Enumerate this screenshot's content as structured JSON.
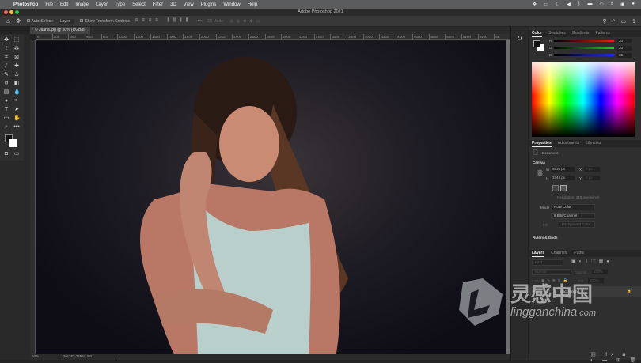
{
  "menubar": {
    "apple": "",
    "app": "Photoshop",
    "items": [
      "File",
      "Edit",
      "Image",
      "Layer",
      "Type",
      "Select",
      "Filter",
      "3D",
      "View",
      "Plugins",
      "Window",
      "Help"
    ]
  },
  "window": {
    "title": "Adobe Photoshop 2021"
  },
  "options": {
    "auto_select_label": "Auto-Select:",
    "auto_select_value": "Layer",
    "transform_label": "Show Transform Controls",
    "mode_3d": "3D Mode:",
    "more": "•••"
  },
  "document": {
    "tab": "© Juana.jpg @ 50% (RGB/8)",
    "zoom": "50%",
    "doc_size": "Doc: 63.2M/63.2M",
    "status_arrow": "›"
  },
  "ruler": {
    "ticks": [
      "0",
      "200",
      "400",
      "600",
      "800",
      "1000",
      "1200",
      "1400",
      "1600",
      "1800",
      "2000",
      "2200",
      "2400",
      "2600",
      "2800",
      "3000",
      "3200",
      "3400",
      "3600",
      "3800",
      "4000",
      "4200",
      "4400",
      "4600",
      "4800",
      "5000",
      "5200",
      "5400",
      "56"
    ]
  },
  "color_panel": {
    "tabs": [
      "Color",
      "Swatches",
      "Gradients",
      "Patterns"
    ],
    "channels": [
      {
        "label": "R",
        "value": "20",
        "color": "#e02020"
      },
      {
        "label": "G",
        "value": "20",
        "color": "#20d020"
      },
      {
        "label": "B",
        "value": "15",
        "color": "#2030e0"
      }
    ],
    "foreground": "#141414",
    "background": "#ffffff"
  },
  "properties_panel": {
    "tabs": [
      "Properties",
      "Adjustments",
      "Libraries"
    ],
    "doc_label": "Document",
    "canvas_section": "Canvas",
    "width": "5616 px",
    "height": "3744 px",
    "x_label": "X",
    "y_label": "Y",
    "x_value": "0 px",
    "y_value": "0 px",
    "w_label": "W",
    "h_label": "H",
    "resolution": "Resolution: 240 pixels/inch",
    "mode_label": "Mode",
    "mode_value": "RGB Color",
    "depth_value": "8 Bits/Channel",
    "fill_label": "Fill",
    "fill_value": "Background Color",
    "rulers_section": "Rulers & Grids"
  },
  "layers_panel": {
    "tabs": [
      "Layers",
      "Channels",
      "Paths"
    ],
    "filter_placeholder": "Kind",
    "blend": "Normal",
    "opacity_label": "Opacity:",
    "opacity_value": "100%",
    "lock_label": "Lock:",
    "fill_label": "Fill:",
    "fill_value": "100%",
    "layer_name": "Background"
  },
  "watermark": {
    "text_cn": "灵感中国",
    "text_en": "lingganchina",
    "text_tld": ".com"
  }
}
